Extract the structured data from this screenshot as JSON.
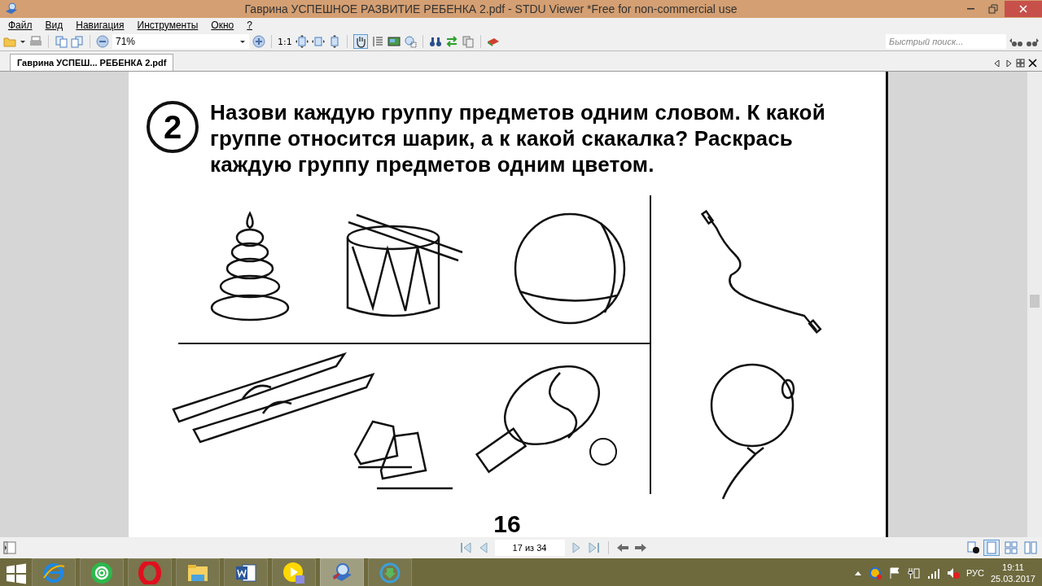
{
  "window": {
    "title": "Гаврина УСПЕШНОЕ РАЗВИТИЕ РЕБЕНКА 2.pdf - STDU Viewer *Free for non-commercial use"
  },
  "menu": [
    {
      "label": "Файл"
    },
    {
      "label": "Вид"
    },
    {
      "label": "Навигация"
    },
    {
      "label": "Инструменты"
    },
    {
      "label": "Окно"
    },
    {
      "label": "?"
    }
  ],
  "toolbar": {
    "zoom": "71%",
    "actual_size": "1:1",
    "hand_tool_selected": true,
    "search_placeholder": "Быстрый поиск..."
  },
  "tabs": [
    {
      "label": "Гаврина УСПЕШ... РЕБЕНКА 2.pdf",
      "selected": true
    }
  ],
  "page": {
    "task_number": "2",
    "instruction_lines": [
      "Назови каждую группу предметов одним словом. К какой",
      "группе относится шарик, а к какой скакалка? Раскрась",
      "каждую группу предметов одним цветом."
    ],
    "page_number": "16"
  },
  "navigation": {
    "page_field": "17 из 34"
  },
  "view_modes": [
    {
      "kind": "single",
      "selected": true
    },
    {
      "kind": "grid",
      "selected": false
    },
    {
      "kind": "facing",
      "selected": false
    }
  ],
  "taskbar": {
    "apps": [
      {
        "kind": "ie",
        "selected": false
      },
      {
        "kind": "mail",
        "selected": false
      },
      {
        "kind": "opera",
        "selected": false
      },
      {
        "kind": "explorer",
        "selected": false
      },
      {
        "kind": "word",
        "selected": false
      },
      {
        "kind": "player",
        "selected": false
      },
      {
        "kind": "viewer",
        "selected": true
      },
      {
        "kind": "download",
        "selected": false
      }
    ],
    "language": "РУС",
    "time": "19:11",
    "date": "25.03.2017"
  }
}
